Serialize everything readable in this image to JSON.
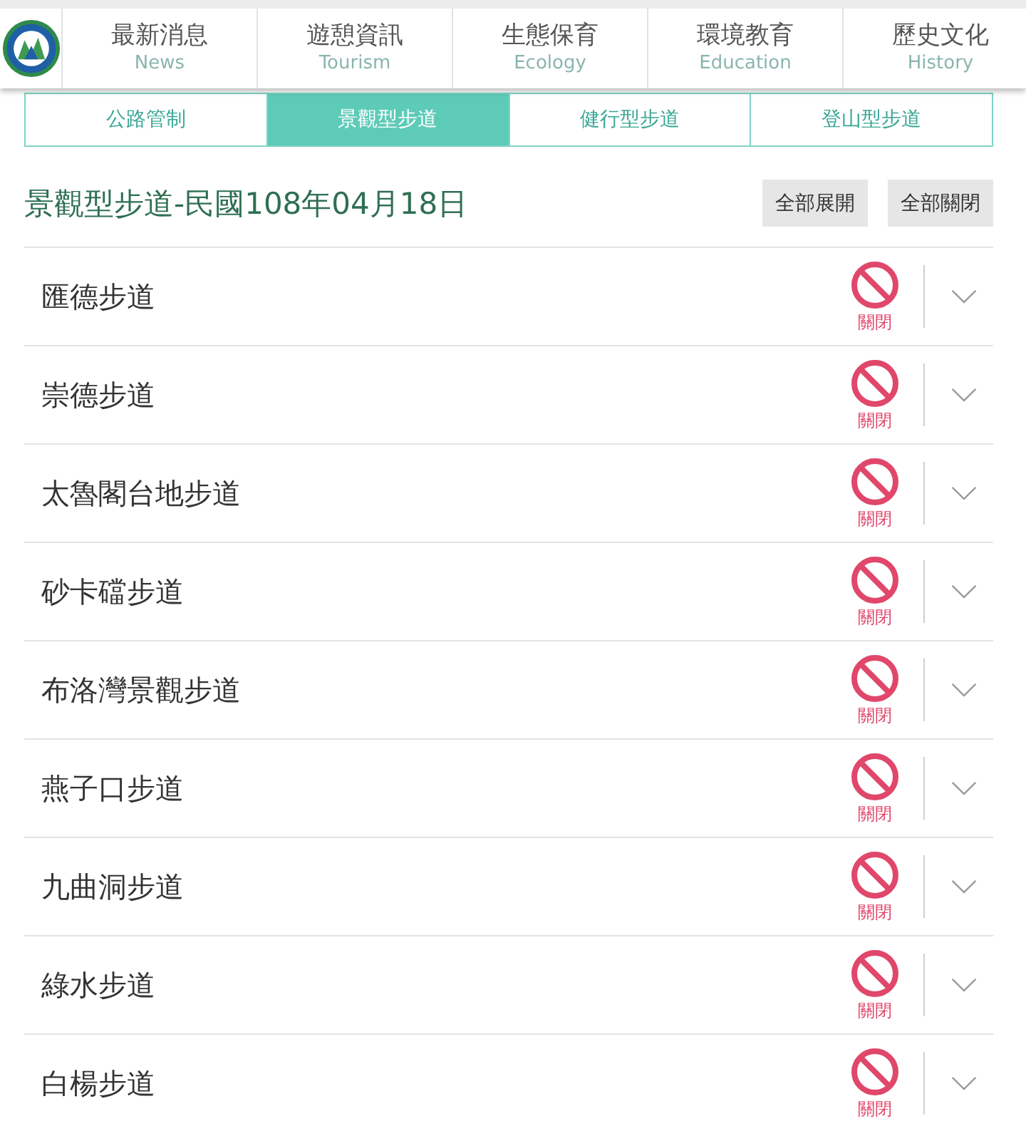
{
  "header": {
    "nav": [
      {
        "label": "最新消息",
        "sublabel": "News"
      },
      {
        "label": "遊憩資訊",
        "sublabel": "Tourism"
      },
      {
        "label": "生態保育",
        "sublabel": "Ecology"
      },
      {
        "label": "環境教育",
        "sublabel": "Education"
      },
      {
        "label": "歷史文化",
        "sublabel": "History"
      }
    ]
  },
  "tabs": [
    {
      "label": "公路管制",
      "selected": false
    },
    {
      "label": "景觀型步道",
      "selected": true
    },
    {
      "label": "健行型步道",
      "selected": false
    },
    {
      "label": "登山型步道",
      "selected": false
    }
  ],
  "section": {
    "title": "景觀型步道-民國108年04月18日",
    "buttons": [
      "全部展開",
      "全部關閉"
    ]
  },
  "trails": [
    {
      "name": "匯德步道",
      "kind": "closed",
      "status": "關閉",
      "expanded": false
    },
    {
      "name": "崇德步道",
      "kind": "closed",
      "status": "關閉",
      "expanded": false
    },
    {
      "name": "太魯閣台地步道",
      "kind": "closed",
      "status": "關閉",
      "expanded": false
    },
    {
      "name": "砂卡礑步道",
      "kind": "closed",
      "status": "關閉",
      "expanded": false
    },
    {
      "name": "布洛灣景觀步道",
      "kind": "closed",
      "status": "關閉",
      "expanded": false
    },
    {
      "name": "燕子口步道",
      "kind": "closed",
      "status": "關閉",
      "expanded": false
    },
    {
      "name": "九曲洞步道",
      "kind": "closed",
      "status": "關閉",
      "expanded": false
    },
    {
      "name": "綠水步道",
      "kind": "closed",
      "status": "關閉",
      "expanded": false
    },
    {
      "name": "白楊步道",
      "kind": "closed",
      "status": "關閉",
      "expanded": false
    }
  ]
}
